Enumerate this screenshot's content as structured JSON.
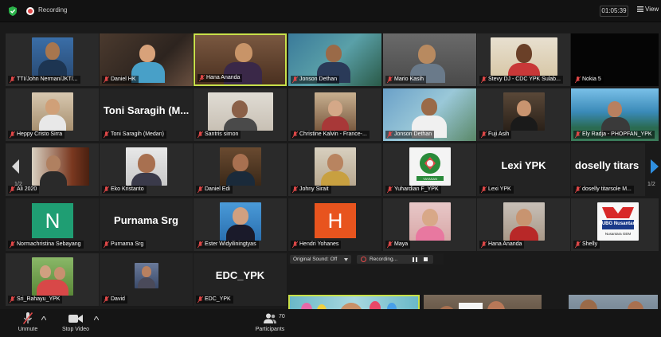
{
  "topbar": {
    "recording_label": "Recording",
    "timer": "01:05:39",
    "view_label": "View"
  },
  "navigation": {
    "page_left": "1/2",
    "page_right": "1/2"
  },
  "participants": [
    {
      "name": "TTI/John Nerman/JKT/...",
      "mic": "muted"
    },
    {
      "name": "Daniel HK",
      "mic": "muted"
    },
    {
      "name": "Hana Ananda",
      "mic": "muted",
      "active": true
    },
    {
      "name": "Jonson Dethan",
      "mic": "muted"
    },
    {
      "name": "Mario Kasih",
      "mic": "muted"
    },
    {
      "name": "Stevy DJ - CDC YPK Sulab...",
      "mic": "muted"
    },
    {
      "name": "Nokia 5",
      "mic": "muted"
    },
    {
      "name": "Heppy Cristo Sirra",
      "mic": "muted"
    },
    {
      "name": "Toni Saragih (Medan)",
      "mic": "muted",
      "big_label": "Toni Saragih  (M..."
    },
    {
      "name": "Santris simon",
      "mic": "muted"
    },
    {
      "name": "Christine Kalvin - France-...",
      "mic": "muted"
    },
    {
      "name": "Jonson Dethan",
      "mic": "muted"
    },
    {
      "name": "Fuji Asih",
      "mic": "muted"
    },
    {
      "name": "Ely Radja - PHOPFAN_YPK",
      "mic": "muted"
    },
    {
      "name": "Ali 2020",
      "mic": "muted"
    },
    {
      "name": "Eko Kristanto",
      "mic": "muted"
    },
    {
      "name": "Daniel Edi",
      "mic": "muted"
    },
    {
      "name": "Johny Sirait",
      "mic": "muted"
    },
    {
      "name": "Yuhardian F_YPK",
      "mic": "muted"
    },
    {
      "name": "Lexi YPK",
      "mic": "muted",
      "big_label": "Lexi YPK"
    },
    {
      "name": "doselly titarsole M...",
      "mic": "muted",
      "big_label": "doselly  titars"
    },
    {
      "name": "Normachristina Sebayang",
      "mic": "muted",
      "avatar_letter": "N"
    },
    {
      "name": "Purnama Srg",
      "mic": "muted",
      "big_label": "Purnama Srg"
    },
    {
      "name": "Ester Widyiliningtyas",
      "mic": "muted"
    },
    {
      "name": "Hendri Yohanes",
      "mic": "muted",
      "avatar_letter": "H"
    },
    {
      "name": "Maya",
      "mic": "muted"
    },
    {
      "name": "Hana Ananda",
      "mic": "muted"
    },
    {
      "name": "Shelly",
      "mic": "muted",
      "logo_text": "PUBG Nusantara",
      "logo_sub": "Nusantara GEM"
    },
    {
      "name": "Sri_Rahayu_YPK",
      "mic": "muted"
    },
    {
      "name": "David",
      "mic": "muted"
    },
    {
      "name": "EDC_YPK",
      "mic": "muted",
      "big_label": "EDC_YPK"
    }
  ],
  "yayasan_logo_text": "YAYASAN",
  "recording_bar": {
    "sound": "Original Sound: Off",
    "status": "Recording..."
  },
  "toolbar": {
    "unmute": "Unmute",
    "stop_video": "Stop Video",
    "participants": "Participants",
    "participants_count": "70"
  },
  "colors": {
    "active_border": "#c8e04a",
    "muted_red": "#e04848",
    "green_avatar": "#1f9e73",
    "orange_avatar": "#e8541e",
    "nav_blue": "#2f8fe0",
    "heart": "#e8263a"
  }
}
